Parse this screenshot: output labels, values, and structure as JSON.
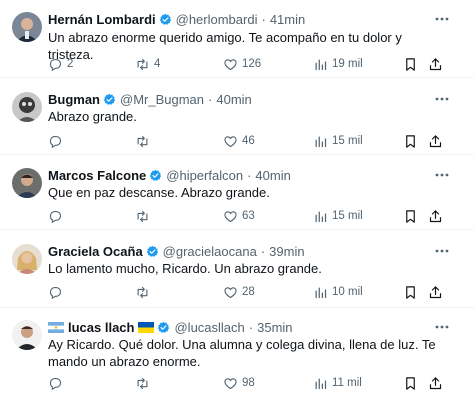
{
  "colors": {
    "verified_blue": "#1d9bf0",
    "text_primary": "#0f1419",
    "text_secondary": "#536471",
    "divider": "#eff3f4"
  },
  "icons": {
    "reply": "reply-icon",
    "retweet": "retweet-icon",
    "like": "heart-icon",
    "views": "views-chart-icon",
    "bookmark": "bookmark-icon",
    "share": "share-icon",
    "more": "more-options-icon",
    "verified": "verified-badge-icon"
  },
  "tweets": [
    {
      "name": "Hernán Lombardi",
      "handle": "@herlombardi",
      "separator": "·",
      "time": "41min",
      "text": "Un abrazo enorme querido amigo. Te acompaño en tu dolor y tristeza.",
      "replies": "2",
      "retweets": "4",
      "likes": "126",
      "views": "19 mil"
    },
    {
      "name": "Bugman",
      "handle": "@Mr_Bugman",
      "separator": "·",
      "time": "40min",
      "text": "Abrazo grande.",
      "replies": "",
      "retweets": "",
      "likes": "46",
      "views": "15 mil"
    },
    {
      "name": "Marcos Falcone",
      "handle": "@hiperfalcon",
      "separator": "·",
      "time": "40min",
      "text": "Que en paz descanse. Abrazo grande.",
      "replies": "",
      "retweets": "",
      "likes": "63",
      "views": "15 mil"
    },
    {
      "name": "Graciela Ocaña",
      "handle": "@gracielaocana",
      "separator": "·",
      "time": "39min",
      "text": "Lo lamento mucho, Ricardo. Un abrazo grande.",
      "replies": "",
      "retweets": "",
      "likes": "28",
      "views": "10 mil"
    },
    {
      "name": "lucas llach",
      "handle": "@lucasllach",
      "separator": "·",
      "time": "35min",
      "text": "Ay Ricardo. Qué dolor. Una alumna y colega divina, llena de luz. Te mando un abrazo enorme.",
      "replies": "",
      "retweets": "",
      "likes": "98",
      "views": "11 mil",
      "name_flags": [
        "argentina-flag",
        "ukraine-flag"
      ]
    }
  ]
}
